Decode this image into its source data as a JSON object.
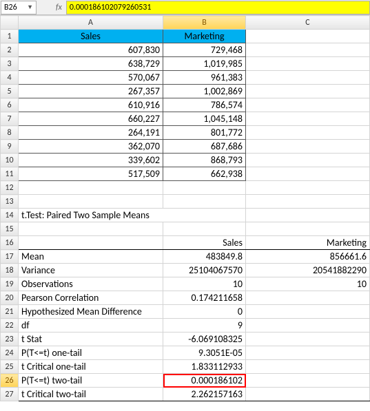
{
  "namebox": "B26",
  "formula": "0.000186102079260531",
  "col_headers": [
    "A",
    "B",
    "C"
  ],
  "row_headers": [
    "1",
    "2",
    "3",
    "4",
    "5",
    "6",
    "7",
    "8",
    "9",
    "10",
    "11",
    "12",
    "13",
    "14",
    "15",
    "16",
    "17",
    "18",
    "19",
    "20",
    "21",
    "22",
    "23",
    "24",
    "25",
    "26",
    "27"
  ],
  "headers": {
    "a": "Sales",
    "b": "Marketing"
  },
  "rows": [
    {
      "a": "607,830",
      "b": "729,468"
    },
    {
      "a": "638,729",
      "b": "1,019,985"
    },
    {
      "a": "570,067",
      "b": "961,383"
    },
    {
      "a": "267,357",
      "b": "1,002,869"
    },
    {
      "a": "610,916",
      "b": "786,574"
    },
    {
      "a": "660,227",
      "b": "1,045,148"
    },
    {
      "a": "264,191",
      "b": "801,772"
    },
    {
      "a": "362,070",
      "b": "687,686"
    },
    {
      "a": "339,602",
      "b": "868,793"
    },
    {
      "a": "517,509",
      "b": "662,938"
    }
  ],
  "title": "t.Test: Paired Two Sample Means",
  "stat_headers": {
    "b": "Sales",
    "c": "Marketing"
  },
  "stats": [
    {
      "label": "Mean",
      "b": "483849.8",
      "c": "856661.6"
    },
    {
      "label": "Variance",
      "b": "25104067570",
      "c": "20541882290"
    },
    {
      "label": "Observations",
      "b": "10",
      "c": "10"
    },
    {
      "label": "Pearson Correlation",
      "b": "0.174211658",
      "c": ""
    },
    {
      "label": "Hypothesized Mean Difference",
      "b": "0",
      "c": ""
    },
    {
      "label": "df",
      "b": "9",
      "c": ""
    },
    {
      "label": "t Stat",
      "b": "-6.069108325",
      "c": ""
    },
    {
      "label": "P(T<=t) one-tail",
      "b": "9.3051E-05",
      "c": ""
    },
    {
      "label": "t Critical one-tail",
      "b": "1.833112933",
      "c": ""
    },
    {
      "label": "P(T<=t) two-tail",
      "b": "0.000186102",
      "c": ""
    },
    {
      "label": "t Critical two-tail",
      "b": "2.262157163",
      "c": ""
    }
  ],
  "chart_data": {
    "type": "table",
    "title": "t.Test: Paired Two Sample Means",
    "series": [
      {
        "name": "Sales",
        "values": [
          607830,
          638729,
          570067,
          267357,
          610916,
          660227,
          264191,
          362070,
          339602,
          517509
        ]
      },
      {
        "name": "Marketing",
        "values": [
          729468,
          1019985,
          961383,
          1002869,
          786574,
          1045148,
          801772,
          687686,
          868793,
          662938
        ]
      }
    ],
    "stats": {
      "Mean": {
        "Sales": 483849.8,
        "Marketing": 856661.6
      },
      "Variance": {
        "Sales": 25104067570,
        "Marketing": 20541882290
      },
      "Observations": {
        "Sales": 10,
        "Marketing": 10
      },
      "Pearson Correlation": 0.174211658,
      "Hypothesized Mean Difference": 0,
      "df": 9,
      "t Stat": -6.069108325,
      "P_one_tail": 9.3051e-05,
      "t Critical one-tail": 1.833112933,
      "P_two_tail": 0.000186102,
      "t Critical two-tail": 2.262157163
    }
  }
}
